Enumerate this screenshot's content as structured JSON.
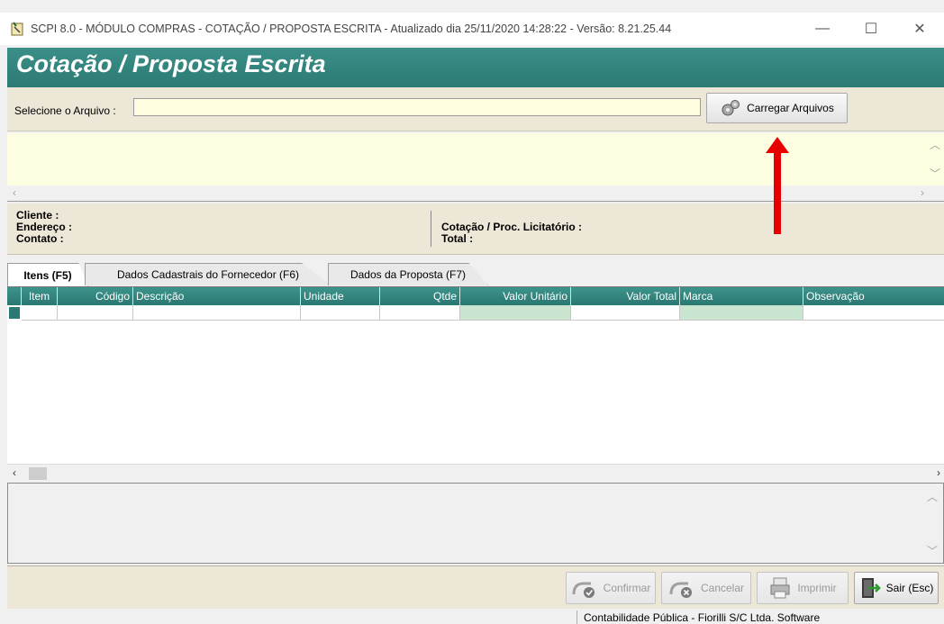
{
  "window": {
    "title": "SCPI 8.0 - MÓDULO COMPRAS - COTAÇÃO / PROPOSTA ESCRITA - Atualizado dia 25/11/2020 14:28:22 - Versão: 8.21.25.44",
    "minimize": "—",
    "maximize": "☐",
    "close": "✕"
  },
  "header": {
    "title": "Cotação / Proposta Escrita"
  },
  "file_selector": {
    "label": "Selecione o Arquivo :",
    "value": "",
    "load_button": "Carregar Arquivos"
  },
  "info": {
    "cliente": "Cliente :",
    "endereco": "Endereço :",
    "contato": "Contato :",
    "cotacao": "Cotação / Proc. Licitatório :",
    "total": "Total :"
  },
  "tabs": [
    {
      "label": "Itens (F5)",
      "active": true
    },
    {
      "label": "Dados Cadastrais do Fornecedor (F6)",
      "active": false
    },
    {
      "label": "Dados da Proposta (F7)",
      "active": false
    }
  ],
  "grid": {
    "columns": [
      "Item",
      "Código",
      "Descrição",
      "Unidade",
      "Qtde",
      "Valor Unitário",
      "Valor Total",
      "Marca",
      "Observação"
    ]
  },
  "buttons": {
    "confirmar": "Confirmar",
    "cancelar": "Cancelar",
    "imprimir": "Imprimir",
    "sair": "Sair (Esc)"
  },
  "status": {
    "text": "Contabilidade Pública - Fiorilli S/C Ltda. Software"
  },
  "colors": {
    "header_teal": "#2c7a74",
    "input_yellow": "#fffde0",
    "highlight_green": "#c9e4cf",
    "annotation_red": "#e60000"
  }
}
